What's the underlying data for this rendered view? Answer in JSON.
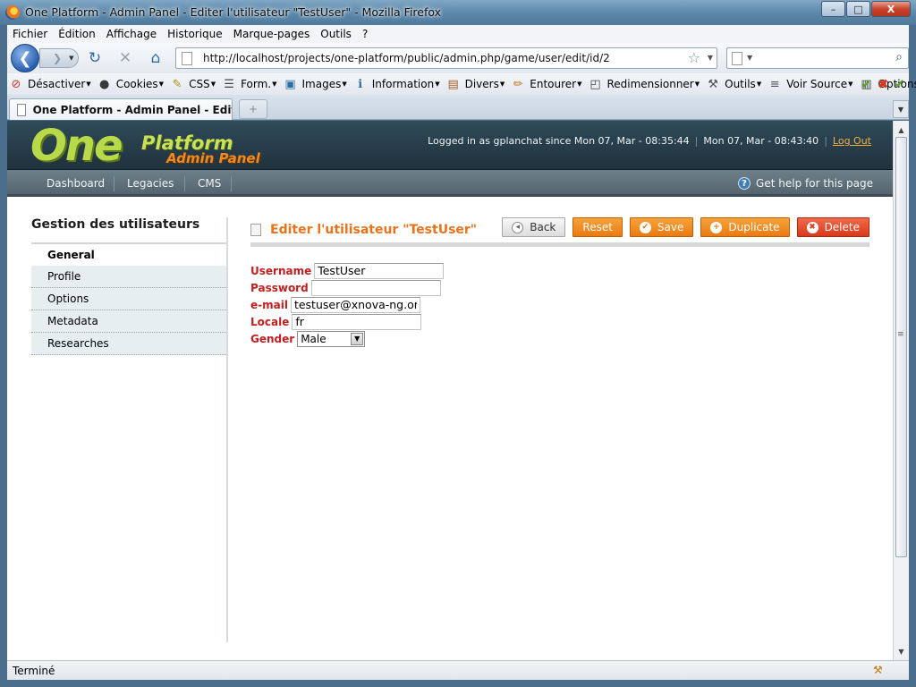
{
  "window": {
    "title": "One Platform - Admin Panel - Editer l'utilisateur \"TestUser\" - Mozilla Firefox",
    "minimize": "–",
    "maximize": "□",
    "close": "X"
  },
  "menubar": {
    "items": [
      "Fichier",
      "Édition",
      "Affichage",
      "Historique",
      "Marque-pages",
      "Outils",
      "?"
    ]
  },
  "navbar": {
    "url": "http://localhost/projects/one-platform/public/admin.php/game/user/edit/id/2",
    "search_placeholder": ""
  },
  "devtoolbar": {
    "items": [
      {
        "label": "Désactiver",
        "icon": "disable-icon",
        "glyph": "⊘",
        "color": "#c0392b"
      },
      {
        "label": "Cookies",
        "icon": "cookies-icon",
        "glyph": "●",
        "color": "#3a3a3a"
      },
      {
        "label": "CSS",
        "icon": "css-icon",
        "glyph": "✎",
        "color": "#b58a18"
      },
      {
        "label": "Form.",
        "icon": "form-icon",
        "glyph": "☰",
        "color": "#444"
      },
      {
        "label": "Images",
        "icon": "images-icon",
        "glyph": "▣",
        "color": "#2e6da4"
      },
      {
        "label": "Information",
        "icon": "information-icon",
        "glyph": "ℹ",
        "color": "#2e6da4"
      },
      {
        "label": "Divers",
        "icon": "divers-icon",
        "glyph": "▤",
        "color": "#a0622c"
      },
      {
        "label": "Entourer",
        "icon": "outline-icon",
        "glyph": "✏",
        "color": "#c0781a"
      },
      {
        "label": "Redimensionner",
        "icon": "resize-icon",
        "glyph": "◰",
        "color": "#444"
      },
      {
        "label": "Outils",
        "icon": "tools-icon",
        "glyph": "⚒",
        "color": "#555"
      },
      {
        "label": "Voir Source",
        "icon": "view-source-icon",
        "glyph": "≡",
        "color": "#555"
      },
      {
        "label": "Options",
        "icon": "options-icon",
        "glyph": "▥",
        "color": "#444"
      }
    ],
    "status_ok": "✔",
    "status_error": "✖",
    "status_ok2": "✔",
    "colors": {
      "ok": "#5aa02c",
      "error": "#d33a1f"
    }
  },
  "tabs": {
    "active_label": "One Platform - Admin Panel - Editer l...",
    "new_tab": "+"
  },
  "site": {
    "logo": {
      "one": "One",
      "platform": "Platform",
      "admin_panel": "Admin Panel"
    },
    "login_text": "Logged in as gplanchat since Mon 07, Mar - 08:35:44",
    "current_time": "Mon 07, Mar - 08:43:40",
    "logout": "Log Out",
    "nav": [
      "Dashboard",
      "Legacies",
      "CMS"
    ],
    "help": "Get help for this page",
    "colors": {
      "accent": "#e8731c",
      "label_red": "#c22020",
      "header_bg": "#2f4a59"
    }
  },
  "sidebar": {
    "heading": "Gestion des utilisateurs",
    "active_item": "General",
    "items": [
      "Profile",
      "Options",
      "Metadata",
      "Researches"
    ]
  },
  "panel": {
    "title": "Editer l'utilisateur \"TestUser\"",
    "buttons": {
      "back": "Back",
      "reset": "Reset",
      "save": "Save",
      "duplicate": "Duplicate",
      "delete": "Delete"
    }
  },
  "form": {
    "username": {
      "label": "Username",
      "value": "TestUser"
    },
    "password": {
      "label": "Password",
      "value": ""
    },
    "email": {
      "label": "e-mail",
      "value": "testuser@xnova-ng.org"
    },
    "locale": {
      "label": "Locale",
      "value": "fr"
    },
    "gender": {
      "label": "Gender",
      "value": "Male"
    }
  },
  "statusbar": {
    "text": "Terminé"
  }
}
